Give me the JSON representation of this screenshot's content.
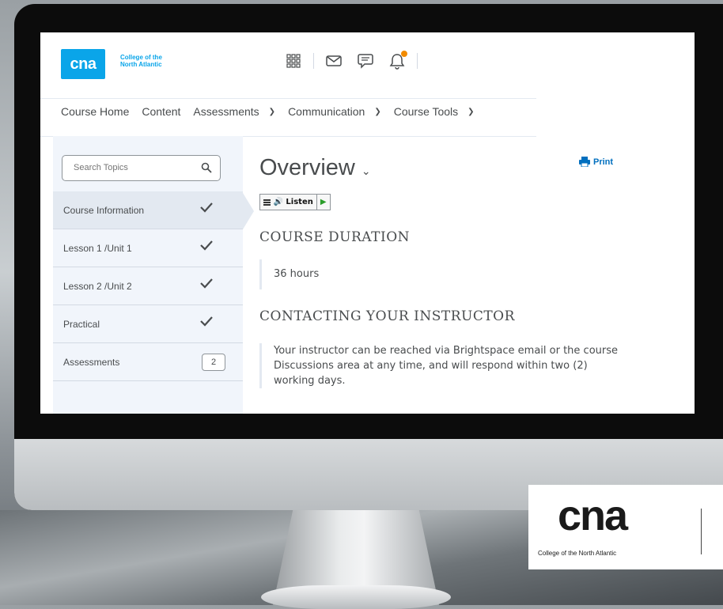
{
  "brand": {
    "logo_short": "cna",
    "logo_line1": "College of the",
    "logo_line2": "North Atlantic",
    "accent": "#0aa5e9"
  },
  "topbar_icons": [
    "waffle-grid-icon",
    "mail-icon",
    "chat-bubble-icon",
    "bell-icon"
  ],
  "nav": {
    "items": [
      {
        "label": "Course Home",
        "has_menu": false
      },
      {
        "label": "Content",
        "has_menu": false
      },
      {
        "label": "Assessments",
        "has_menu": true
      },
      {
        "label": "Communication",
        "has_menu": true
      },
      {
        "label": "Course Tools",
        "has_menu": true
      }
    ]
  },
  "sidebar": {
    "search_placeholder": "Search Topics",
    "items": [
      {
        "label": "Course Information",
        "status": "check",
        "active": true
      },
      {
        "label": "Lesson 1 /Unit 1",
        "status": "check"
      },
      {
        "label": "Lesson 2 /Unit 2",
        "status": "check"
      },
      {
        "label": "Practical",
        "status": "check"
      },
      {
        "label": "Assessments",
        "status": "count",
        "count": "2"
      }
    ]
  },
  "main": {
    "title": "Overview",
    "print_label": "Print",
    "listen_label": "Listen",
    "sections": [
      {
        "heading": "COURSE DURATION",
        "body": "36 hours"
      },
      {
        "heading": "CONTACTING YOUR INSTRUCTOR",
        "body_lines": [
          "Your instructor can be reached via Brightspace email or the course",
          "Discussions area at any time, and will respond within two (2)",
          "working days."
        ]
      }
    ]
  },
  "overlay_logo": {
    "short": "cna",
    "full": "College of the North Atlantic"
  }
}
